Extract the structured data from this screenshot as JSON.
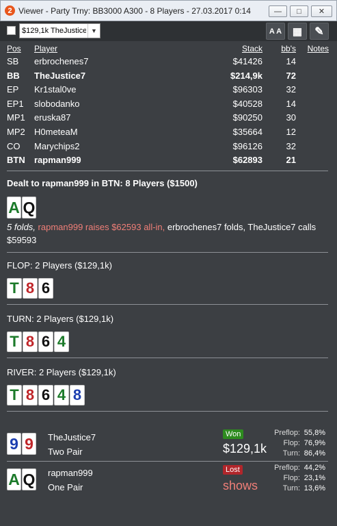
{
  "window": {
    "badge_number": "2",
    "title": "Viewer - Party Trny: BB3000 A300 - 8 Players - 27.03.2017 0:14",
    "minimize": "—",
    "maximize": "□",
    "close": "✕"
  },
  "toolbar": {
    "combo_value": "$129,1k TheJustice7",
    "combo_arrow": "▼",
    "font_button": "A A",
    "grid_button": "▦",
    "edit_button": "✎"
  },
  "players_table": {
    "headers": {
      "pos": "Pos",
      "player": "Player",
      "stack": "Stack",
      "bbs": "bb's",
      "notes": "Notes"
    },
    "rows": [
      {
        "pos": "SB",
        "player": "erbrochenes7",
        "stack": "$41426",
        "bbs": "14",
        "bold": false
      },
      {
        "pos": "BB",
        "player": "TheJustice7",
        "stack": "$214,9k",
        "bbs": "72",
        "bold": true
      },
      {
        "pos": "EP",
        "player": "Kr1stal0ve",
        "stack": "$96303",
        "bbs": "32",
        "bold": false
      },
      {
        "pos": "EP1",
        "player": "slobodanko",
        "stack": "$40528",
        "bbs": "14",
        "bold": false
      },
      {
        "pos": "MP1",
        "player": "eruska87",
        "stack": "$90250",
        "bbs": "30",
        "bold": false
      },
      {
        "pos": "MP2",
        "player": "H0meteaM",
        "stack": "$35664",
        "bbs": "12",
        "bold": false
      },
      {
        "pos": "CO",
        "player": "Marychips2",
        "stack": "$96126",
        "bbs": "32",
        "bold": false
      },
      {
        "pos": "BTN",
        "player": "rapman999",
        "stack": "$62893",
        "bbs": "21",
        "bold": true
      }
    ]
  },
  "preflop": {
    "title": "Dealt to rapman999 in BTN: 8 Players ($1500)",
    "cards": [
      {
        "rank": "A",
        "suit": "c"
      },
      {
        "rank": "Q",
        "suit": "s"
      }
    ],
    "action_folds": "5 folds,",
    "action_raise": " rapman999 raises $62593 all-in,",
    "action_rest": " erbrochenes7 folds, TheJustice7 calls $59593"
  },
  "flop": {
    "title": "FLOP: 2 Players ($129,1k)",
    "cards": [
      {
        "rank": "T",
        "suit": "c"
      },
      {
        "rank": "8",
        "suit": "h"
      },
      {
        "rank": "6",
        "suit": "s"
      }
    ]
  },
  "turn": {
    "title": "TURN: 2 Players ($129,1k)",
    "cards": [
      {
        "rank": "T",
        "suit": "c"
      },
      {
        "rank": "8",
        "suit": "h"
      },
      {
        "rank": "6",
        "suit": "s"
      },
      {
        "rank": "4",
        "suit": "c"
      }
    ]
  },
  "river": {
    "title": "RIVER: 2 Players ($129,1k)",
    "cards": [
      {
        "rank": "T",
        "suit": "c"
      },
      {
        "rank": "8",
        "suit": "h"
      },
      {
        "rank": "6",
        "suit": "s"
      },
      {
        "rank": "4",
        "suit": "c"
      },
      {
        "rank": "8",
        "suit": "d"
      }
    ]
  },
  "results": [
    {
      "cards": [
        {
          "rank": "9",
          "suit": "d"
        },
        {
          "rank": "9",
          "suit": "h"
        }
      ],
      "player": "TheJustice7",
      "hand": "Two Pair",
      "badge": "Won",
      "badge_type": "won",
      "amount": "$129,1k",
      "amount_type": "normal",
      "equity": [
        {
          "label": "Preflop:",
          "value": "55,8%"
        },
        {
          "label": "Flop:",
          "value": "76,9%"
        },
        {
          "label": "Turn:",
          "value": "86,4%"
        }
      ]
    },
    {
      "cards": [
        {
          "rank": "A",
          "suit": "c"
        },
        {
          "rank": "Q",
          "suit": "s"
        }
      ],
      "player": "rapman999",
      "hand": "One Pair",
      "badge": "Lost",
      "badge_type": "lost",
      "amount": "shows",
      "amount_type": "shows",
      "equity": [
        {
          "label": "Preflop:",
          "value": "44,2%"
        },
        {
          "label": "Flop:",
          "value": "23,1%"
        },
        {
          "label": "Turn:",
          "value": "13,6%"
        }
      ]
    }
  ],
  "colors": {
    "background": "#3c3f43",
    "club": "#1c7a2a",
    "spade": "#111111",
    "heart": "#c0262a",
    "diamond": "#1d3fb0",
    "won": "#2e8b1f",
    "lost": "#b1262b",
    "raise_text": "#f07f78"
  }
}
